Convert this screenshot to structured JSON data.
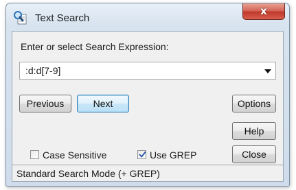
{
  "window": {
    "title": "Text Search",
    "close_glyph": "x",
    "title_icon": "magnifier-document-icon"
  },
  "search": {
    "prompt": "Enter or select Search Expression:",
    "expression": ":d:d[7-9]"
  },
  "buttons": {
    "previous": "Previous",
    "next": "Next",
    "options": "Options",
    "help": "Help",
    "close": "Close"
  },
  "checkboxes": {
    "case_sensitive": {
      "label": "Case Sensitive",
      "checked": false
    },
    "use_grep": {
      "label": "Use GREP",
      "checked": true
    }
  },
  "status": {
    "text": "Standard Search Mode (+ GREP)"
  },
  "colors": {
    "close_button": "#c0392b",
    "focused_button_border": "#3c7fb1",
    "window_frame": "#cfdceb"
  }
}
